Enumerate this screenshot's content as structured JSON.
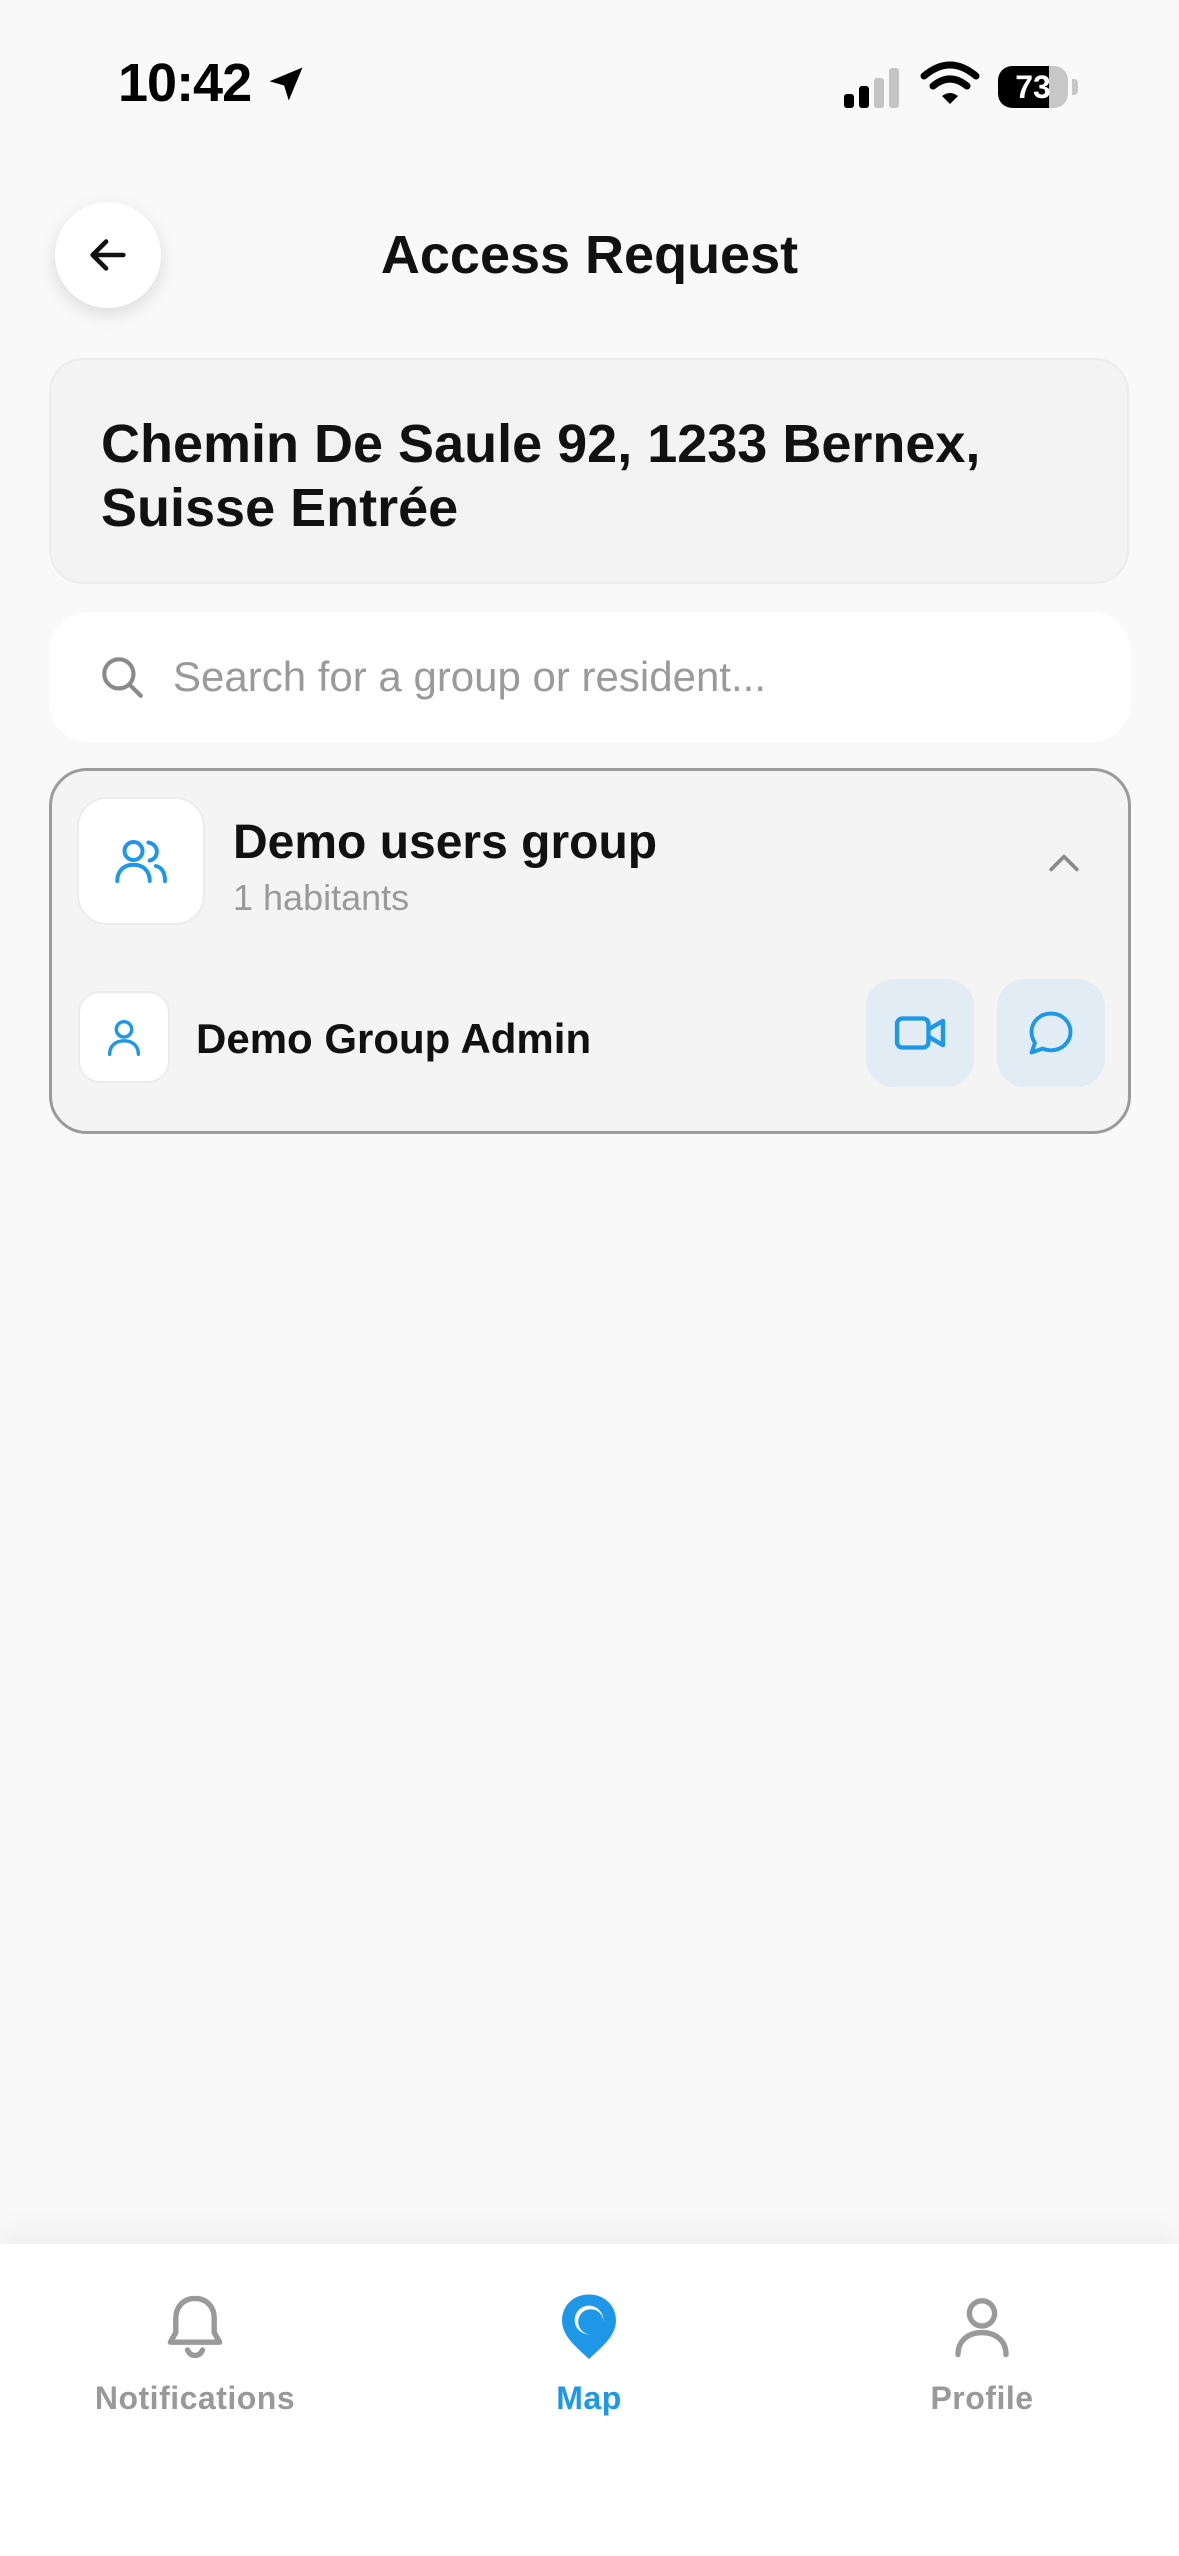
{
  "status_bar": {
    "time": "10:42",
    "battery": "73",
    "battery_level": 0.73
  },
  "header": {
    "title": "Access Request",
    "back_icon": "arrow-left-icon"
  },
  "address": {
    "text": "Chemin De Saule 92, 1233 Bernex, Suisse Entrée"
  },
  "search": {
    "placeholder": "Search for a group or resident...",
    "value": ""
  },
  "group": {
    "name": "Demo users group",
    "count": "1 habitants",
    "expanded": true,
    "members": [
      {
        "name": "Demo Group Admin",
        "actions": [
          "video-call",
          "chat"
        ]
      }
    ]
  },
  "nav": {
    "items": [
      {
        "label": "Notifications",
        "icon": "bell-icon",
        "active": false
      },
      {
        "label": "Map",
        "icon": "map-pin-icon",
        "active": true
      },
      {
        "label": "Profile",
        "icon": "user-icon",
        "active": false
      }
    ]
  },
  "colors": {
    "accent": "#1e97e8",
    "inactive": "#999999",
    "background": "#f9f9f9",
    "action_bg": "#e1ecf5"
  }
}
